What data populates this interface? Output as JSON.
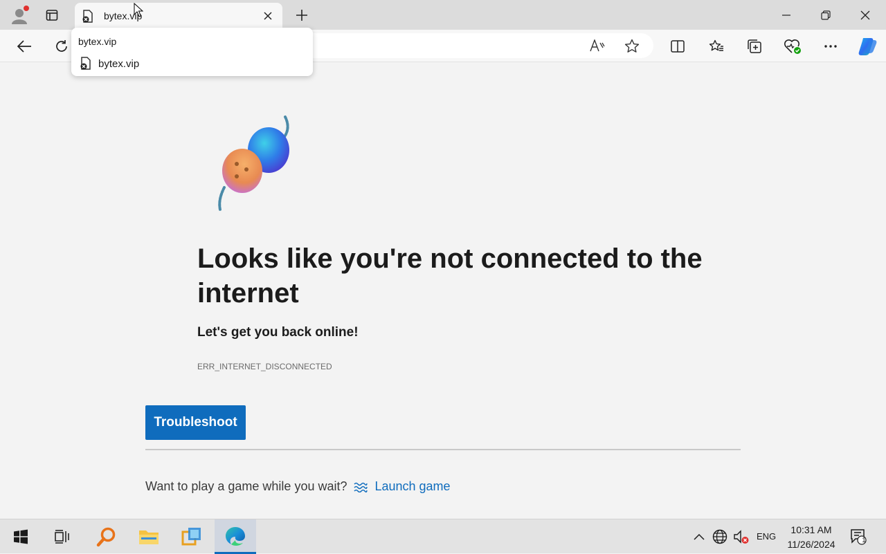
{
  "tab": {
    "title": "bytex.vip"
  },
  "hover_card": {
    "title": "bytex.vip",
    "item": "bytex.vip"
  },
  "error_page": {
    "headline": "Looks like you're not connected to the internet",
    "subheading": "Let's get you back online!",
    "error_code": "ERR_INTERNET_DISCONNECTED",
    "troubleshoot_label": "Troubleshoot",
    "game_prompt": "Want to play a game while you wait?",
    "launch_game_label": "Launch game"
  },
  "toolbar_icons": [
    "back-icon",
    "refresh-icon",
    "read-aloud-icon",
    "favorite-star-icon",
    "split-screen-icon",
    "favorites-icon",
    "collections-icon",
    "browser-essentials-icon",
    "more-icon",
    "copilot-icon"
  ],
  "taskbar": {
    "apps": [
      "start-icon",
      "task-view-icon",
      "search-icon",
      "file-explorer-icon",
      "remote-app-icon",
      "edge-icon"
    ],
    "language": "ENG",
    "time": "10:31 AM",
    "date": "11/26/2024",
    "notification_count": "1"
  },
  "colors": {
    "accent": "#0f6cbd",
    "page_bg": "#f3f3f3",
    "titlebar_bg": "#dcdcdc"
  }
}
